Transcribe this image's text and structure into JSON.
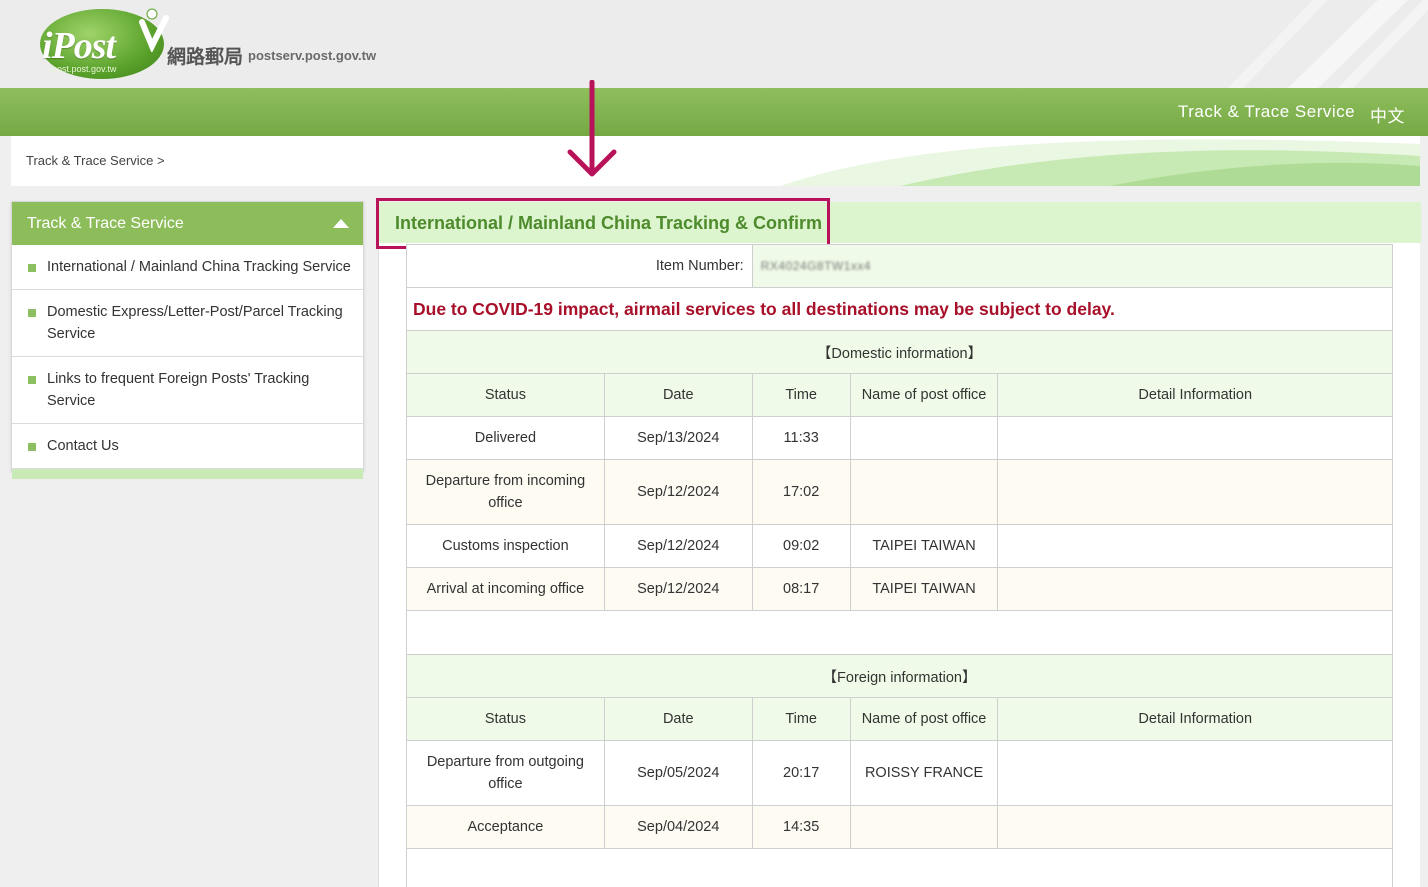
{
  "header": {
    "logo_text": "iPost",
    "logo_sub": "ipost.post.gov.tw",
    "logo_cn": "網路郵局",
    "logo_url": "postserv.post.gov.tw"
  },
  "nav": {
    "track_label": "Track & Trace Service",
    "lang_label": "中文"
  },
  "breadcrumb": "Track & Trace Service >",
  "sidebar": {
    "title": "Track & Trace Service",
    "items": [
      {
        "label": "International / Mainland China Tracking Service"
      },
      {
        "label": "Domestic Express/Letter-Post/Parcel Tracking Service"
      },
      {
        "label": "Links to frequent Foreign Posts' Tracking Service"
      },
      {
        "label": "Contact Us"
      }
    ]
  },
  "main": {
    "title": "International / Mainland China Tracking & Confirm",
    "item_number_label": "Item Number:",
    "item_number_value": "RX4024G8TW1xx4",
    "notice": "Due to COVID-19 impact, airmail services to all destinations may be subject to delay.",
    "domestic": {
      "title": "【Domestic information】",
      "headers": [
        "Status",
        "Date",
        "Time",
        "Name of post office",
        "Detail Information"
      ],
      "rows": [
        {
          "status": "Delivered",
          "date": "Sep/13/2024",
          "time": "11:33",
          "office": "",
          "detail": ""
        },
        {
          "status": "Departure from incoming office",
          "date": "Sep/12/2024",
          "time": "17:02",
          "office": "",
          "detail": ""
        },
        {
          "status": "Customs inspection",
          "date": "Sep/12/2024",
          "time": "09:02",
          "office": "TAIPEI TAIWAN",
          "detail": ""
        },
        {
          "status": "Arrival at incoming office",
          "date": "Sep/12/2024",
          "time": "08:17",
          "office": "TAIPEI TAIWAN",
          "detail": ""
        }
      ]
    },
    "foreign": {
      "title": "【Foreign information】",
      "headers": [
        "Status",
        "Date",
        "Time",
        "Name of post office",
        "Detail Information"
      ],
      "rows": [
        {
          "status": "Departure from outgoing office",
          "date": "Sep/05/2024",
          "time": "20:17",
          "office": "ROISSY FRANCE",
          "detail": ""
        },
        {
          "status": "Acceptance",
          "date": "Sep/04/2024",
          "time": "14:35",
          "office": "",
          "detail": ""
        }
      ]
    }
  },
  "colors": {
    "brand_green": "#8dbd5b",
    "title_green": "#4e8b2c",
    "annotation": "#b8125a",
    "notice_red": "#a8102a"
  }
}
